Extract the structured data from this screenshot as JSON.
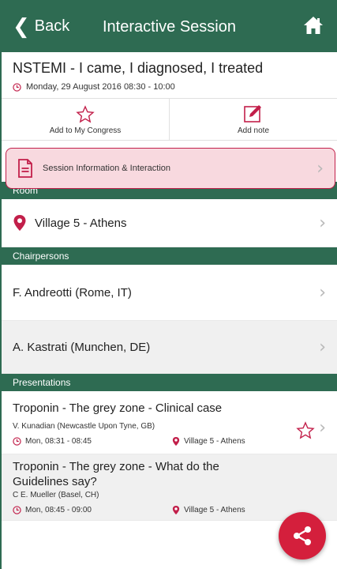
{
  "header": {
    "back_label": "Back",
    "title": "Interactive Session",
    "home_icon": "home-icon"
  },
  "session": {
    "title": "NSTEMI - I came, I diagnosed, I treated",
    "date": "Monday, 29 August 2016 08:30 - 10:00"
  },
  "actions": {
    "add_to_congress": "Add to My Congress",
    "add_note": "Add note"
  },
  "info_row": {
    "label": "Session Information & Interaction"
  },
  "room": {
    "section_label": "Room",
    "name": "Village 5 - Athens"
  },
  "chairpersons": {
    "section_label": "Chairpersons",
    "items": [
      {
        "name": "F. Andreotti (Rome, IT)"
      },
      {
        "name": "A. Kastrati (Munchen, DE)"
      }
    ]
  },
  "presentations": {
    "section_label": "Presentations",
    "items": [
      {
        "title": "Troponin - The grey zone - Clinical case",
        "author": "V. Kunadian (Newcastle Upon Tyne, GB)",
        "time": "Mon, 08:31 - 08:45",
        "location": "Village 5 - Athens"
      },
      {
        "title": "Troponin - The grey zone - What do the Guidelines say?",
        "author": "C E. Mueller (Basel, CH)",
        "time": "Mon, 08:45 - 09:00",
        "location": "Village 5 - Athens"
      }
    ]
  },
  "colors": {
    "brand_green": "#2e6b52",
    "accent_red": "#c21f4a",
    "highlight_pink": "#f8d9df"
  }
}
